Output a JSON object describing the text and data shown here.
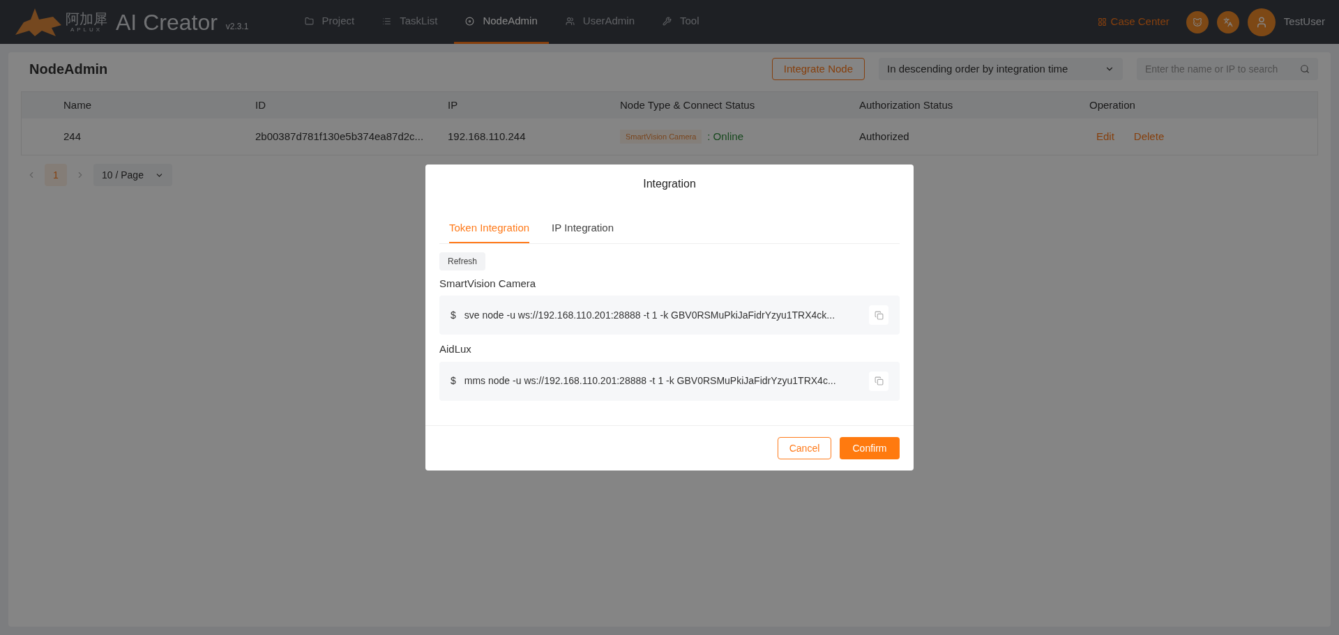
{
  "header": {
    "logo": {
      "chinese": "阿加犀",
      "latin": "APLUX"
    },
    "app_name": "AI Creator",
    "version": "v2.3.1",
    "nav": [
      {
        "label": "Project",
        "selected": false
      },
      {
        "label": "TaskList",
        "selected": false
      },
      {
        "label": "NodeAdmin",
        "selected": true
      },
      {
        "label": "UserAdmin",
        "selected": false
      },
      {
        "label": "Tool",
        "selected": false
      }
    ],
    "case_center": "Case Center",
    "user": "TestUser"
  },
  "page": {
    "title": "NodeAdmin",
    "integrate_button": "Integrate Node",
    "sort": "In descending order by integration time",
    "search": {
      "placeholder": "Enter the name or IP to search"
    }
  },
  "table": {
    "columns": [
      "Name",
      "ID",
      "IP",
      "Node Type & Connect Status",
      "Authorization Status",
      "Operation"
    ],
    "rows": [
      {
        "name": "244",
        "id": "2b00387d781f130e5b374ea87d2c...",
        "ip": "192.168.110.244",
        "node_type": "SmartVision Camera",
        "status": ": Online",
        "online": true,
        "authorization": "Authorized",
        "actions": [
          "Edit",
          "Delete"
        ]
      }
    ]
  },
  "pagination": {
    "pages": [
      {
        "label": "1",
        "selected": true
      }
    ],
    "page_size": "10 / Page"
  },
  "dialog": {
    "title": "Integration",
    "tabs": [
      {
        "label": "Token Integration",
        "selected": true
      },
      {
        "label": "IP Integration",
        "selected": false
      }
    ],
    "refresh": "Refresh",
    "commands": [
      {
        "label": "SmartVision Camera",
        "prompt": "$",
        "command": "sve node -u ws://192.168.110.201:28888 -t 1 -k GBV0RSMuPkiJaFidrYzyu1TRX4ck..."
      },
      {
        "label": "AidLux",
        "prompt": "$",
        "command": "mms node -u ws://192.168.110.201:28888 -t 1 -k GBV0RSMuPkiJaFidrYzyu1TRX4c..."
      }
    ],
    "cancel": "Cancel",
    "confirm": "Confirm"
  }
}
